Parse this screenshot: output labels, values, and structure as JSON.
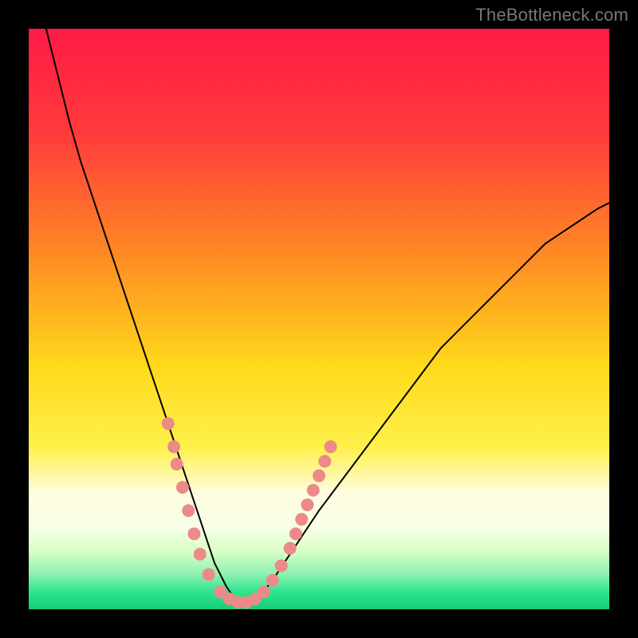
{
  "watermark": "TheBottleneck.com",
  "chart_data": {
    "type": "line",
    "title": "",
    "xlabel": "",
    "ylabel": "",
    "xlim": [
      0,
      100
    ],
    "ylim": [
      0,
      100
    ],
    "grid": false,
    "legend": false,
    "background_gradient_stops": [
      {
        "offset": 0.0,
        "color": "#ff1a47"
      },
      {
        "offset": 0.18,
        "color": "#ff3b3b"
      },
      {
        "offset": 0.4,
        "color": "#ff8e23"
      },
      {
        "offset": 0.58,
        "color": "#ffd91a"
      },
      {
        "offset": 0.72,
        "color": "#fff04a"
      },
      {
        "offset": 0.8,
        "color": "#fffde0"
      },
      {
        "offset": 0.86,
        "color": "#f7ffe6"
      },
      {
        "offset": 0.9,
        "color": "#d8ffc6"
      },
      {
        "offset": 0.94,
        "color": "#8cf2b0"
      },
      {
        "offset": 0.97,
        "color": "#2fe38f"
      },
      {
        "offset": 1.0,
        "color": "#14cf78"
      }
    ],
    "series": [
      {
        "name": "bottleneck-curve",
        "stroke": "#000000",
        "stroke_width": 2,
        "x": [
          3,
          5,
          7,
          9,
          11,
          13,
          15,
          17,
          19,
          21,
          22,
          23,
          24,
          25,
          26,
          27,
          28,
          29,
          30,
          31,
          32,
          33,
          34,
          35,
          36,
          37,
          38,
          39,
          40,
          42,
          44,
          46,
          48,
          50,
          53,
          56,
          59,
          62,
          65,
          68,
          71,
          74,
          77,
          80,
          83,
          86,
          89,
          92,
          95,
          98,
          100
        ],
        "y": [
          100,
          92,
          84,
          77,
          71,
          65,
          59,
          53,
          47,
          41,
          38,
          35,
          32,
          29,
          26,
          23,
          20,
          17,
          14,
          11,
          8,
          6,
          4,
          2.5,
          1.5,
          1,
          1,
          1.5,
          2.5,
          5,
          8,
          11,
          14,
          17,
          21,
          25,
          29,
          33,
          37,
          41,
          45,
          48,
          51,
          54,
          57,
          60,
          63,
          65,
          67,
          69,
          70
        ]
      }
    ],
    "scatter_overlay": {
      "name": "highlight-dots",
      "fill": "#ec8a8a",
      "radius": 8,
      "points": [
        {
          "x": 24,
          "y": 32
        },
        {
          "x": 25,
          "y": 28
        },
        {
          "x": 25.5,
          "y": 25
        },
        {
          "x": 26.5,
          "y": 21
        },
        {
          "x": 27.5,
          "y": 17
        },
        {
          "x": 28.5,
          "y": 13
        },
        {
          "x": 29.5,
          "y": 9.5
        },
        {
          "x": 31,
          "y": 6
        },
        {
          "x": 33,
          "y": 3
        },
        {
          "x": 34.5,
          "y": 1.8
        },
        {
          "x": 36,
          "y": 1.2
        },
        {
          "x": 37.5,
          "y": 1.2
        },
        {
          "x": 39,
          "y": 1.8
        },
        {
          "x": 40.5,
          "y": 3
        },
        {
          "x": 42,
          "y": 5
        },
        {
          "x": 43.5,
          "y": 7.5
        },
        {
          "x": 45,
          "y": 10.5
        },
        {
          "x": 46,
          "y": 13
        },
        {
          "x": 47,
          "y": 15.5
        },
        {
          "x": 48,
          "y": 18
        },
        {
          "x": 49,
          "y": 20.5
        },
        {
          "x": 50,
          "y": 23
        },
        {
          "x": 51,
          "y": 25.5
        },
        {
          "x": 52,
          "y": 28
        }
      ]
    }
  }
}
